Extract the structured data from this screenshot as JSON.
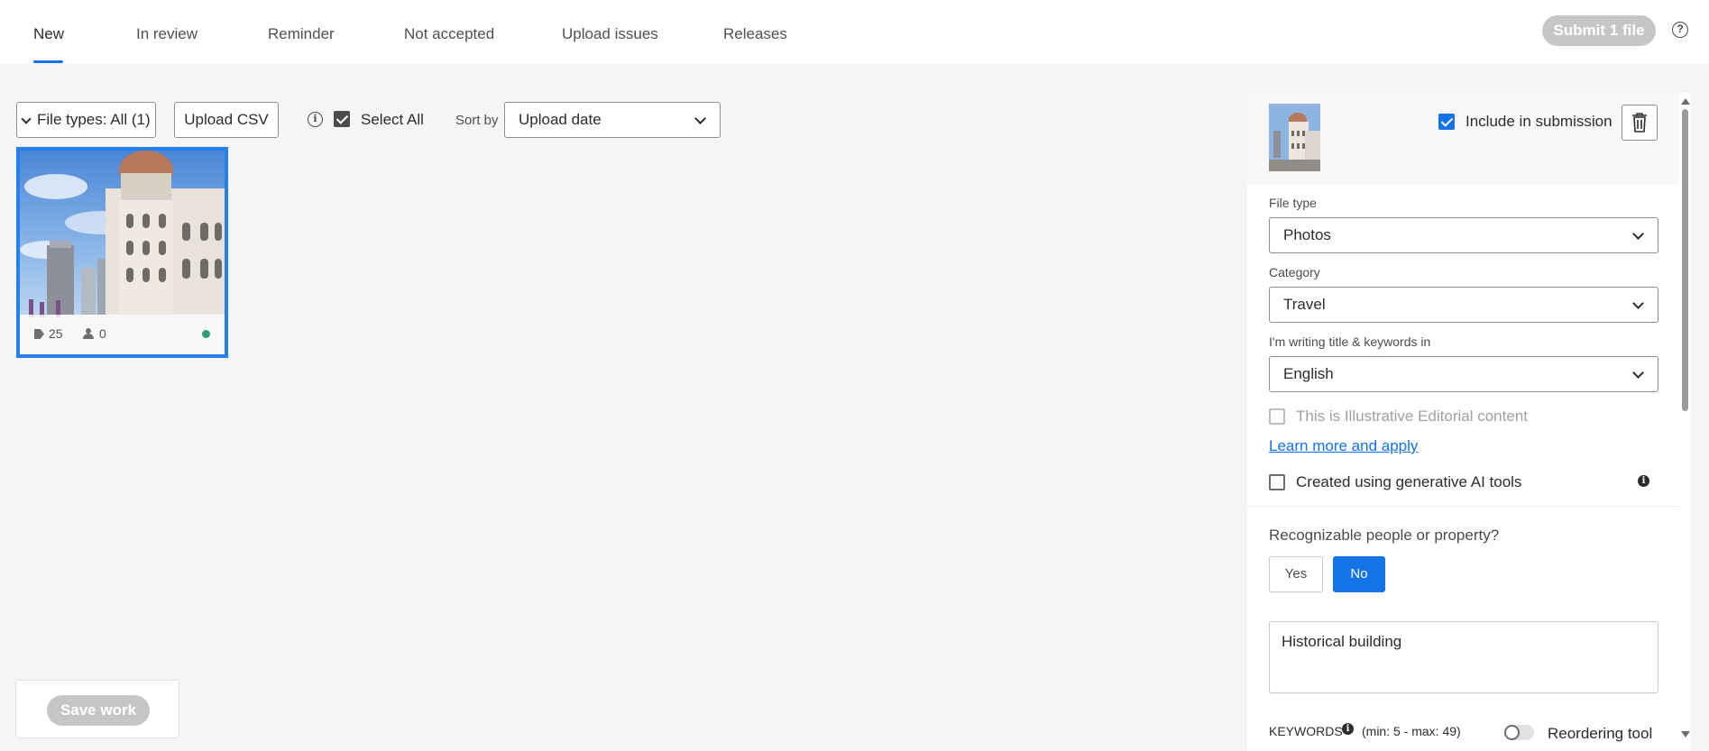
{
  "tabs": [
    {
      "label": "New",
      "active": true
    },
    {
      "label": "In review"
    },
    {
      "label": "Reminder"
    },
    {
      "label": "Not accepted"
    },
    {
      "label": "Upload issues"
    },
    {
      "label": "Releases"
    }
  ],
  "header": {
    "submit_label": "Submit 1 file",
    "help_icon": "question-circle-icon"
  },
  "toolbar": {
    "file_types_label": "File types: All (1)",
    "upload_csv_label": "Upload CSV",
    "select_all_label": "Select All",
    "select_all_checked": true,
    "sort_by_label": "Sort by",
    "sort_value": "Upload date"
  },
  "thumbnail": {
    "keywords_count": "25",
    "releases_count": "0",
    "status_color": "#2d9d78"
  },
  "save_work_label": "Save work",
  "panel": {
    "include_label": "Include in submission",
    "include_checked": true,
    "file_type_label": "File type",
    "file_type_value": "Photos",
    "category_label": "Category",
    "category_value": "Travel",
    "language_label": "I'm writing title & keywords in",
    "language_value": "English",
    "editorial_label": "This is Illustrative Editorial content",
    "learn_more_label": "Learn more and apply",
    "ai_label": "Created using generative AI tools",
    "recognizable_label": "Recognizable people or property?",
    "yes_label": "Yes",
    "no_label": "No",
    "title_value": "Historical building",
    "keywords_label": "KEYWORDS",
    "keywords_range": "(min: 5 - max: 49)",
    "reorder_label": "Reordering tool"
  },
  "colors": {
    "accent": "#1473e6",
    "selection_border": "#2680eb",
    "disabled_button": "#c6c6c6"
  }
}
